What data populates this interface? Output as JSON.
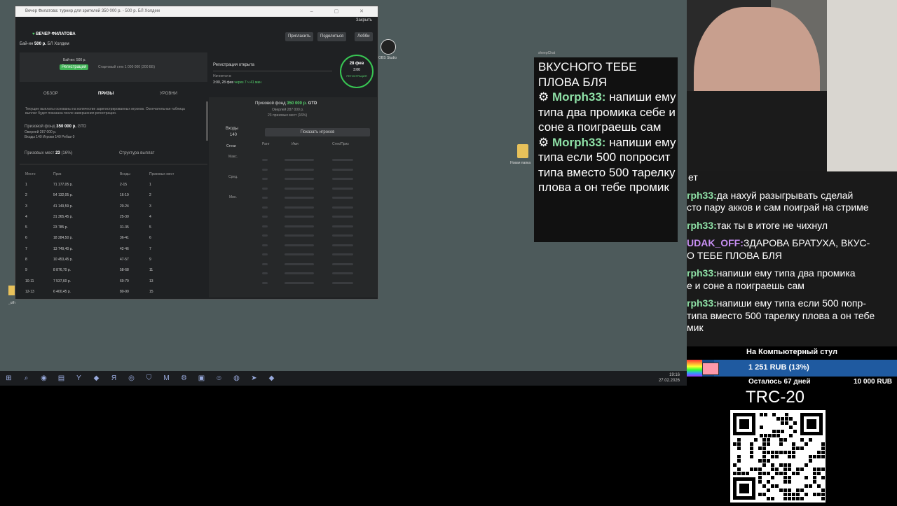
{
  "window": {
    "title": "Вечер Филатова: турнир для зрителей 350 000 р. - 500 р. БЛ Холдем",
    "close_link": "Закрыть",
    "brand": "ВЕЧЕР ФИЛАТОВА",
    "buyin_label": "Бай-ин",
    "buyin_value": "500 р.",
    "buyin_game": "БЛ Холдем",
    "buttons": {
      "invite": "Пригласить",
      "share": "Поделиться",
      "lobby": "Лобби"
    },
    "reg_panel": {
      "buyin": "Бай-ин: 500 р.",
      "register_btn": "Регистрация",
      "stack": "Стартовый стек 1 000 000 (200 ББ)",
      "reg_open": "Регистрация открыта",
      "starts": "Начнется в",
      "start_time": "3:00, 28 фев",
      "countdown": "через 7 ч 41 мин"
    },
    "badge": {
      "date": "28 фев",
      "time": "3:00",
      "label": "РЕГИСТРАЦИЯ"
    },
    "tabs": [
      "ОБЗОР",
      "ПРИЗЫ",
      "УРОВНИ"
    ],
    "info_text": "Текущие выплаты основаны на количестве зарегистрированных игроков. Окончательная таблица выплат будет показана после завершения регистрации.",
    "prize": {
      "label": "Призовой фонд",
      "value": "350 000 р.",
      "gtd": "GTD",
      "overlay": "Оверлей 287 000 р.",
      "entries": "Входы 140",
      "players": "Игроки 140",
      "rebuys": "Ребаи 0",
      "places_label": "Призовых мест",
      "places_value": "23",
      "places_pct": "(16%)",
      "structure": "Структура выплат"
    },
    "table": {
      "headers": [
        "Место",
        "Приз",
        "Входы",
        "Призовых мест"
      ],
      "rows": [
        [
          "1",
          "71 177,05 р.",
          "2-15",
          "1"
        ],
        [
          "2",
          "54 132,05 р.",
          "16-19",
          "2"
        ],
        [
          "3",
          "41 149,59 р.",
          "20-24",
          "3"
        ],
        [
          "4",
          "31 365,45 р.",
          "25-30",
          "4"
        ],
        [
          "5",
          "23 785 р.",
          "31-35",
          "5"
        ],
        [
          "6",
          "18 284,50 р.",
          "36-41",
          "6"
        ],
        [
          "7",
          "13 749,40 р.",
          "42-46",
          "7"
        ],
        [
          "8",
          "10 453,45 р.",
          "47-57",
          "9"
        ],
        [
          "9",
          "8 876,70 р.",
          "58-68",
          "11"
        ],
        [
          "10-11",
          "7 537,60 р.",
          "69-79",
          "13"
        ],
        [
          "12-13",
          "6 400,45 р.",
          "80-90",
          "15"
        ]
      ]
    },
    "right_panel": {
      "prize_label": "Призовой фонд",
      "prize_value": "350 000 р.",
      "gtd": "GTD",
      "overlay": "Оверлей 287 000 р.",
      "places": "23 призовых мест (16%)",
      "entries_label": "Входы",
      "entries_value": "140",
      "stacks_label": "Стеки",
      "max": "Макс.",
      "avg": "Сред.",
      "min": "Мин.",
      "show_players": "Показать игроков",
      "cols": [
        "Ранг",
        "Имя",
        "Стек/Приз"
      ]
    }
  },
  "desktop": {
    "obs_label": "OBS Studio",
    "folder_label": "Новая папка",
    "left_label": "_uth"
  },
  "taskbar": {
    "time": "19:16",
    "date": "27.02.2026"
  },
  "overlay_chat": {
    "source": "sheepChat",
    "first": "ВКУСНОГО ТЕБЕ ПЛОВА БЛЯ",
    "msg1_user": "Morph33:",
    "msg1_text": "напиши ему типа два промика себе и соне а поиграешь сам",
    "msg2_user": "Morph33:",
    "msg2_text": "напиши ему типа если 500 попросит типа вместо 500 тарелку плова а он тебе промик"
  },
  "side_chat": {
    "l0": "ет",
    "m1_user": "rph33:",
    "m1_text": "да нахуй разыгрывать сделай",
    "m1_cont": "сто пару акков и сам поиграй на стриме",
    "m2_user": "rph33:",
    "m2_text": "так ты в итоге не чихнул",
    "m3_user": "UDAK_OFF:",
    "m3_text": "ЗДАРОВА БРАТУХА, ВКУС-",
    "m3_cont": "О ТЕБЕ ПЛОВА БЛЯ",
    "m4_user": "rph33:",
    "m4_text": "напиши ему типа два промика",
    "m4_cont": "е и соне а поиграешь сам",
    "m5_user": "rph33:",
    "m5_text": "напиши ему типа если 500 попр-",
    "m5_cont": "типа вместо 500 тарелку плова а он тебе",
    "m5_cont2": "мик"
  },
  "goal": {
    "title": "На Компьютерный стул",
    "amount": "1 251 RUB (13%)",
    "progress_pct": 13,
    "days_left": "Осталось 67 дней",
    "target": "10 000 RUB",
    "crypto": "TRC-20"
  },
  "colors": {
    "accent": "#3fb455",
    "desktop": "#4d5a5b",
    "chat_user": "#8ee0a6"
  }
}
